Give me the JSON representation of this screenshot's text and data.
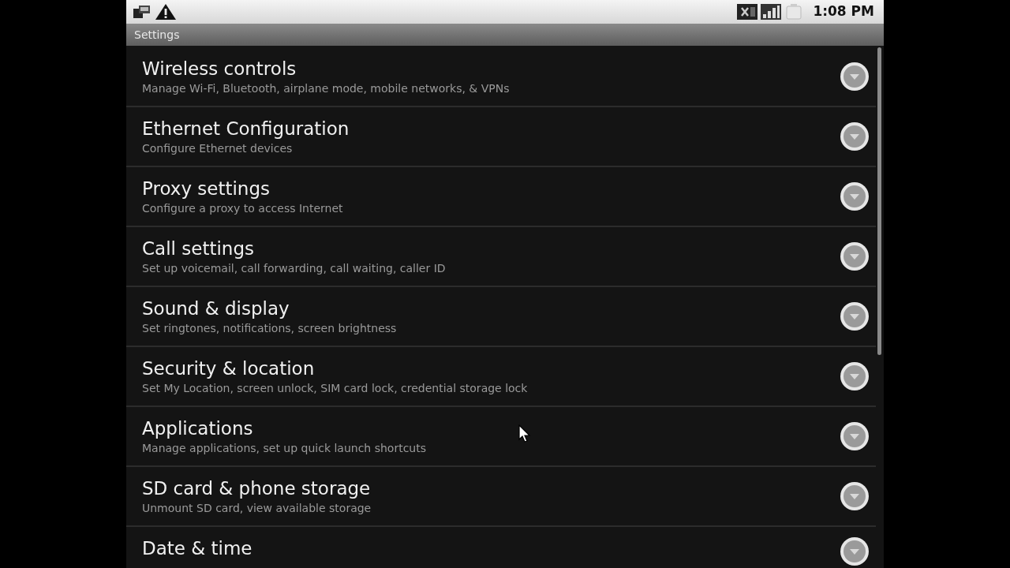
{
  "status_bar": {
    "time": "1:08 PM"
  },
  "title_bar": {
    "title": "Settings"
  },
  "settings_items": [
    {
      "title": "Wireless controls",
      "summary": "Manage Wi-Fi, Bluetooth, airplane mode, mobile networks, & VPNs"
    },
    {
      "title": "Ethernet Configuration",
      "summary": "Configure Ethernet devices"
    },
    {
      "title": "Proxy settings",
      "summary": "Configure a proxy to access Internet"
    },
    {
      "title": "Call settings",
      "summary": "Set up voicemail, call forwarding, call waiting, caller ID"
    },
    {
      "title": "Sound & display",
      "summary": "Set ringtones, notifications, screen brightness"
    },
    {
      "title": "Security & location",
      "summary": "Set My Location, screen unlock, SIM card lock, credential storage lock"
    },
    {
      "title": "Applications",
      "summary": "Manage applications, set up quick launch shortcuts"
    },
    {
      "title": "SD card & phone storage",
      "summary": "Unmount SD card, view available storage"
    },
    {
      "title": "Date & time"
    }
  ]
}
